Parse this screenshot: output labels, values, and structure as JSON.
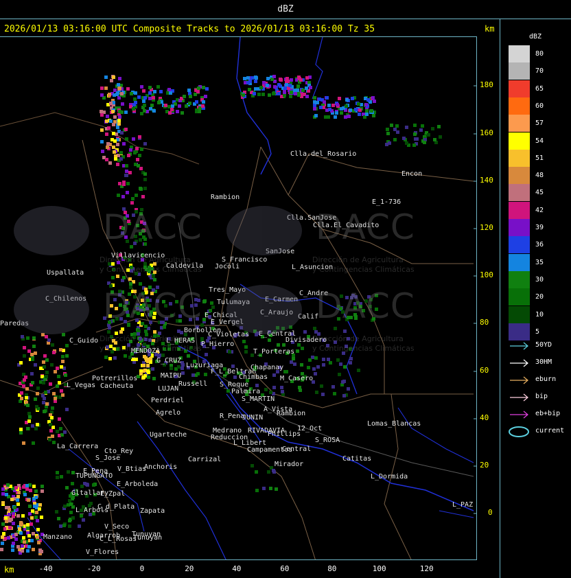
{
  "window_title": "dBZ",
  "header_text": "2026/01/13 03:16:00 UTC Composite Tracks to 2026/01/13 03:16:00 Tz 35",
  "axis_unit_top": "km",
  "axis_unit_bottom": "km",
  "y_ticks": [
    "180",
    "160",
    "140",
    "120",
    "100",
    "80",
    "60",
    "40",
    "20",
    "0"
  ],
  "x_ticks": [
    "-40",
    "-20",
    "0",
    "20",
    "40",
    "60",
    "80",
    "100",
    "120"
  ],
  "legend": {
    "title": "dBZ",
    "levels": [
      {
        "label": "80",
        "color": "#d4d4d4"
      },
      {
        "label": "70",
        "color": "#b4b4b4"
      },
      {
        "label": "65",
        "color": "#f03c2c"
      },
      {
        "label": "60",
        "color": "#ff6a10"
      },
      {
        "label": "57",
        "color": "#fc9a4e"
      },
      {
        "label": "54",
        "color": "#ffff00"
      },
      {
        "label": "51",
        "color": "#f8c02c"
      },
      {
        "label": "48",
        "color": "#d8893c"
      },
      {
        "label": "45",
        "color": "#c0707c"
      },
      {
        "label": "42",
        "color": "#d0147c"
      },
      {
        "label": "39",
        "color": "#7810c8"
      },
      {
        "label": "36",
        "color": "#1e40e4"
      },
      {
        "label": "35",
        "color": "#1484e0"
      },
      {
        "label": "30",
        "color": "#108010"
      },
      {
        "label": "20",
        "color": "#087008"
      },
      {
        "label": "10",
        "color": "#044a04"
      },
      {
        "label": "5",
        "color": "#3a2c86"
      }
    ]
  },
  "track_legend": [
    {
      "label": "50YD",
      "color": "#5cd0e0",
      "icon": "arrow-icon"
    },
    {
      "label": "30HM",
      "color": "#ffffff",
      "icon": "arrow-icon"
    },
    {
      "label": "eburn",
      "color": "#e8b060",
      "icon": "arrow-icon"
    },
    {
      "label": "bip",
      "color": "#ffd0e0",
      "icon": "arrow-icon"
    },
    {
      "label": "eb+bip",
      "color": "#e040e0",
      "icon": "arrow-icon"
    },
    {
      "label": "current",
      "color": "#5cd0e0",
      "icon": "ellipse-icon"
    }
  ],
  "watermark": {
    "name": "DACC",
    "line1": "Dirección de Agricultura",
    "line2": "y Contingencias Climáticas"
  },
  "places": [
    "Clla.del_Rosario",
    "Encon",
    "E_1-736",
    "Rambion",
    "Clla.SanJose",
    "Clla.El_Cavadito",
    "Villavicencio",
    "Caldevila",
    "S_Francisco",
    "SanJose",
    "L_Asuncion",
    "Uspallata",
    "Tres_Mayo",
    "Jocoli",
    "C_Andre",
    "E_Carmen",
    "C_Chilenos",
    "Tulumaya",
    "C_Araujo",
    "Calif",
    "E_Chical",
    "E_Vergel",
    "Borbollon",
    "C_Violetas",
    "E_Central",
    "Divisadero",
    "C_Guido",
    "L_HERAS",
    "P_Hierro",
    "T_Porteras",
    "MENDOZA",
    "G_CRUZ",
    "Chapanay",
    "Luzuriaga",
    "F_L_Beltran",
    "MAIPU",
    "Chimbas",
    "M_Casero",
    "Potrerillos",
    "Cacheuta",
    "Russell",
    "S_Roque",
    "L_Vegas",
    "LUJAN",
    "Palmira",
    "Perdriel",
    "S_MARTIN",
    "A_Vista",
    "Rambion",
    "Agrelo",
    "R_Pena",
    "JUNIN",
    "Ugarteche",
    "Medrano",
    "RIVADAVIA",
    "Phillips",
    "12_Oct",
    "Lomas_Blancas",
    "Reduccion",
    "L_Libert",
    "S_ROSA",
    "La_Carrera",
    "Cto_Rey",
    "S_Jose",
    "Carrizal",
    "Campamentos",
    "Central",
    "Catitas",
    "E_Pena",
    "V_Btias",
    "Anchoris",
    "Mirador",
    "TUPUNGATO",
    "E_Arboleda",
    "L_Dormida",
    "Gltallary",
    "E_Zpal",
    "C_d_Plata",
    "L_Arbols",
    "Zapata",
    "V_Seco",
    "Tunuyan",
    "Algarrob",
    "Manzano",
    "C_L_Rosas",
    "V_Flores",
    "L_PAZ",
    "Paredas",
    "Tunuyan"
  ]
}
